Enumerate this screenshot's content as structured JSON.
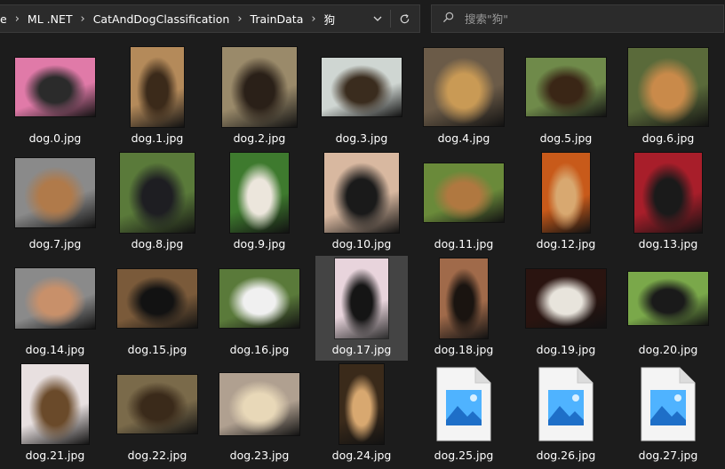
{
  "address_bar": {
    "crumbs": [
      "e",
      "ML .NET",
      "CatAndDogClassification",
      "TrainData",
      "狗"
    ]
  },
  "search": {
    "placeholder": "搜索\"狗\""
  },
  "files": [
    {
      "name": "dog.0.jpg",
      "kind": "photo",
      "colors": [
        "#e07aa8",
        "#2b2b2b"
      ]
    },
    {
      "name": "dog.1.jpg",
      "kind": "photo",
      "colors": [
        "#b48a5a",
        "#3b2a1a"
      ]
    },
    {
      "name": "dog.2.jpg",
      "kind": "photo",
      "colors": [
        "#9a8a6a",
        "#2a2018"
      ]
    },
    {
      "name": "dog.3.jpg",
      "kind": "photo",
      "colors": [
        "#cfd6d2",
        "#3a2c1e"
      ]
    },
    {
      "name": "dog.4.jpg",
      "kind": "photo",
      "colors": [
        "#6b5b48",
        "#c99a55"
      ]
    },
    {
      "name": "dog.5.jpg",
      "kind": "photo",
      "colors": [
        "#6f8a4a",
        "#3a2616"
      ]
    },
    {
      "name": "dog.6.jpg",
      "kind": "photo",
      "colors": [
        "#5a6a3a",
        "#c98a4a"
      ]
    },
    {
      "name": "dog.7.jpg",
      "kind": "photo",
      "colors": [
        "#8a8a8a",
        "#b07a4a"
      ]
    },
    {
      "name": "dog.8.jpg",
      "kind": "photo",
      "colors": [
        "#5a7a3a",
        "#1e1e22"
      ]
    },
    {
      "name": "dog.9.jpg",
      "kind": "photo",
      "colors": [
        "#3e7a2e",
        "#ece6dc"
      ]
    },
    {
      "name": "dog.10.jpg",
      "kind": "photo",
      "colors": [
        "#d8b8a0",
        "#1a1a1a"
      ]
    },
    {
      "name": "dog.11.jpg",
      "kind": "photo",
      "colors": [
        "#6a8a3a",
        "#b07840"
      ]
    },
    {
      "name": "dog.12.jpg",
      "kind": "photo",
      "colors": [
        "#c85a1a",
        "#d8a870"
      ]
    },
    {
      "name": "dog.13.jpg",
      "kind": "photo",
      "colors": [
        "#a81e2a",
        "#1a1a1a"
      ]
    },
    {
      "name": "dog.14.jpg",
      "kind": "photo",
      "colors": [
        "#8a8a8a",
        "#c8906a"
      ]
    },
    {
      "name": "dog.15.jpg",
      "kind": "photo",
      "colors": [
        "#7a5a3a",
        "#121212"
      ]
    },
    {
      "name": "dog.16.jpg",
      "kind": "photo",
      "colors": [
        "#5a7a3a",
        "#f0f0f0"
      ]
    },
    {
      "name": "dog.17.jpg",
      "kind": "photo",
      "colors": [
        "#e8d4dc",
        "#151515"
      ]
    },
    {
      "name": "dog.18.jpg",
      "kind": "photo",
      "colors": [
        "#a06a4a",
        "#1a1410"
      ]
    },
    {
      "name": "dog.19.jpg",
      "kind": "photo",
      "colors": [
        "#2a1410",
        "#e8e4dc"
      ]
    },
    {
      "name": "dog.20.jpg",
      "kind": "photo",
      "colors": [
        "#7aa84a",
        "#1a1a1a"
      ]
    },
    {
      "name": "dog.21.jpg",
      "kind": "photo",
      "colors": [
        "#e8e0e0",
        "#6a4a2a"
      ]
    },
    {
      "name": "dog.22.jpg",
      "kind": "photo",
      "colors": [
        "#7a6a4a",
        "#3a2a1a"
      ]
    },
    {
      "name": "dog.23.jpg",
      "kind": "photo",
      "colors": [
        "#b0a090",
        "#e8d8b8"
      ]
    },
    {
      "name": "dog.24.jpg",
      "kind": "photo",
      "colors": [
        "#3a2a1a",
        "#d8a870"
      ]
    },
    {
      "name": "dog.25.jpg",
      "kind": "icon",
      "colors": [
        "#1e6fc8",
        "#4fb3ff"
      ]
    },
    {
      "name": "dog.26.jpg",
      "kind": "icon",
      "colors": [
        "#1e6fc8",
        "#4fb3ff"
      ]
    },
    {
      "name": "dog.27.jpg",
      "kind": "icon",
      "colors": [
        "#1e6fc8",
        "#4fb3ff"
      ]
    }
  ],
  "selected_file": "dog.17.jpg"
}
